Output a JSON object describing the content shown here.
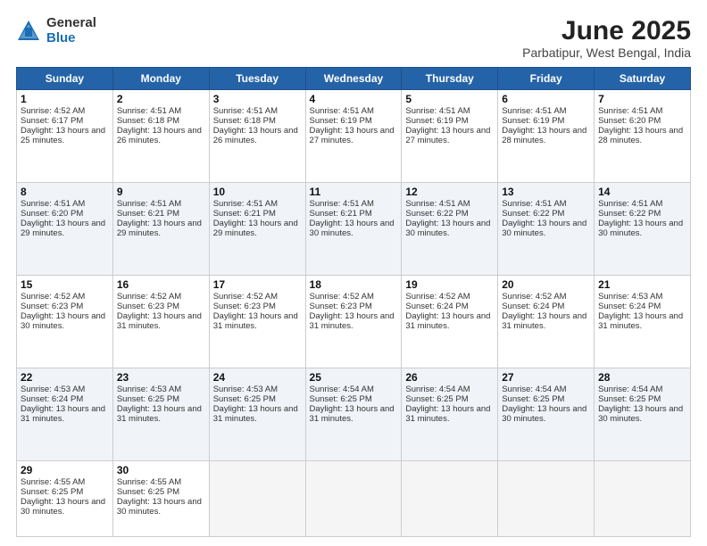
{
  "logo": {
    "general": "General",
    "blue": "Blue"
  },
  "title": {
    "month": "June 2025",
    "location": "Parbatipur, West Bengal, India"
  },
  "days_header": [
    "Sunday",
    "Monday",
    "Tuesday",
    "Wednesday",
    "Thursday",
    "Friday",
    "Saturday"
  ],
  "weeks": [
    [
      {
        "day": "1",
        "sunrise": "Sunrise: 4:52 AM",
        "sunset": "Sunset: 6:17 PM",
        "daylight": "Daylight: 13 hours and 25 minutes."
      },
      {
        "day": "2",
        "sunrise": "Sunrise: 4:51 AM",
        "sunset": "Sunset: 6:18 PM",
        "daylight": "Daylight: 13 hours and 26 minutes."
      },
      {
        "day": "3",
        "sunrise": "Sunrise: 4:51 AM",
        "sunset": "Sunset: 6:18 PM",
        "daylight": "Daylight: 13 hours and 26 minutes."
      },
      {
        "day": "4",
        "sunrise": "Sunrise: 4:51 AM",
        "sunset": "Sunset: 6:19 PM",
        "daylight": "Daylight: 13 hours and 27 minutes."
      },
      {
        "day": "5",
        "sunrise": "Sunrise: 4:51 AM",
        "sunset": "Sunset: 6:19 PM",
        "daylight": "Daylight: 13 hours and 27 minutes."
      },
      {
        "day": "6",
        "sunrise": "Sunrise: 4:51 AM",
        "sunset": "Sunset: 6:19 PM",
        "daylight": "Daylight: 13 hours and 28 minutes."
      },
      {
        "day": "7",
        "sunrise": "Sunrise: 4:51 AM",
        "sunset": "Sunset: 6:20 PM",
        "daylight": "Daylight: 13 hours and 28 minutes."
      }
    ],
    [
      {
        "day": "8",
        "sunrise": "Sunrise: 4:51 AM",
        "sunset": "Sunset: 6:20 PM",
        "daylight": "Daylight: 13 hours and 29 minutes."
      },
      {
        "day": "9",
        "sunrise": "Sunrise: 4:51 AM",
        "sunset": "Sunset: 6:21 PM",
        "daylight": "Daylight: 13 hours and 29 minutes."
      },
      {
        "day": "10",
        "sunrise": "Sunrise: 4:51 AM",
        "sunset": "Sunset: 6:21 PM",
        "daylight": "Daylight: 13 hours and 29 minutes."
      },
      {
        "day": "11",
        "sunrise": "Sunrise: 4:51 AM",
        "sunset": "Sunset: 6:21 PM",
        "daylight": "Daylight: 13 hours and 30 minutes."
      },
      {
        "day": "12",
        "sunrise": "Sunrise: 4:51 AM",
        "sunset": "Sunset: 6:22 PM",
        "daylight": "Daylight: 13 hours and 30 minutes."
      },
      {
        "day": "13",
        "sunrise": "Sunrise: 4:51 AM",
        "sunset": "Sunset: 6:22 PM",
        "daylight": "Daylight: 13 hours and 30 minutes."
      },
      {
        "day": "14",
        "sunrise": "Sunrise: 4:51 AM",
        "sunset": "Sunset: 6:22 PM",
        "daylight": "Daylight: 13 hours and 30 minutes."
      }
    ],
    [
      {
        "day": "15",
        "sunrise": "Sunrise: 4:52 AM",
        "sunset": "Sunset: 6:23 PM",
        "daylight": "Daylight: 13 hours and 30 minutes."
      },
      {
        "day": "16",
        "sunrise": "Sunrise: 4:52 AM",
        "sunset": "Sunset: 6:23 PM",
        "daylight": "Daylight: 13 hours and 31 minutes."
      },
      {
        "day": "17",
        "sunrise": "Sunrise: 4:52 AM",
        "sunset": "Sunset: 6:23 PM",
        "daylight": "Daylight: 13 hours and 31 minutes."
      },
      {
        "day": "18",
        "sunrise": "Sunrise: 4:52 AM",
        "sunset": "Sunset: 6:23 PM",
        "daylight": "Daylight: 13 hours and 31 minutes."
      },
      {
        "day": "19",
        "sunrise": "Sunrise: 4:52 AM",
        "sunset": "Sunset: 6:24 PM",
        "daylight": "Daylight: 13 hours and 31 minutes."
      },
      {
        "day": "20",
        "sunrise": "Sunrise: 4:52 AM",
        "sunset": "Sunset: 6:24 PM",
        "daylight": "Daylight: 13 hours and 31 minutes."
      },
      {
        "day": "21",
        "sunrise": "Sunrise: 4:53 AM",
        "sunset": "Sunset: 6:24 PM",
        "daylight": "Daylight: 13 hours and 31 minutes."
      }
    ],
    [
      {
        "day": "22",
        "sunrise": "Sunrise: 4:53 AM",
        "sunset": "Sunset: 6:24 PM",
        "daylight": "Daylight: 13 hours and 31 minutes."
      },
      {
        "day": "23",
        "sunrise": "Sunrise: 4:53 AM",
        "sunset": "Sunset: 6:25 PM",
        "daylight": "Daylight: 13 hours and 31 minutes."
      },
      {
        "day": "24",
        "sunrise": "Sunrise: 4:53 AM",
        "sunset": "Sunset: 6:25 PM",
        "daylight": "Daylight: 13 hours and 31 minutes."
      },
      {
        "day": "25",
        "sunrise": "Sunrise: 4:54 AM",
        "sunset": "Sunset: 6:25 PM",
        "daylight": "Daylight: 13 hours and 31 minutes."
      },
      {
        "day": "26",
        "sunrise": "Sunrise: 4:54 AM",
        "sunset": "Sunset: 6:25 PM",
        "daylight": "Daylight: 13 hours and 31 minutes."
      },
      {
        "day": "27",
        "sunrise": "Sunrise: 4:54 AM",
        "sunset": "Sunset: 6:25 PM",
        "daylight": "Daylight: 13 hours and 30 minutes."
      },
      {
        "day": "28",
        "sunrise": "Sunrise: 4:54 AM",
        "sunset": "Sunset: 6:25 PM",
        "daylight": "Daylight: 13 hours and 30 minutes."
      }
    ],
    [
      {
        "day": "29",
        "sunrise": "Sunrise: 4:55 AM",
        "sunset": "Sunset: 6:25 PM",
        "daylight": "Daylight: 13 hours and 30 minutes."
      },
      {
        "day": "30",
        "sunrise": "Sunrise: 4:55 AM",
        "sunset": "Sunset: 6:25 PM",
        "daylight": "Daylight: 13 hours and 30 minutes."
      },
      {
        "day": "",
        "sunrise": "",
        "sunset": "",
        "daylight": ""
      },
      {
        "day": "",
        "sunrise": "",
        "sunset": "",
        "daylight": ""
      },
      {
        "day": "",
        "sunrise": "",
        "sunset": "",
        "daylight": ""
      },
      {
        "day": "",
        "sunrise": "",
        "sunset": "",
        "daylight": ""
      },
      {
        "day": "",
        "sunrise": "",
        "sunset": "",
        "daylight": ""
      }
    ]
  ]
}
